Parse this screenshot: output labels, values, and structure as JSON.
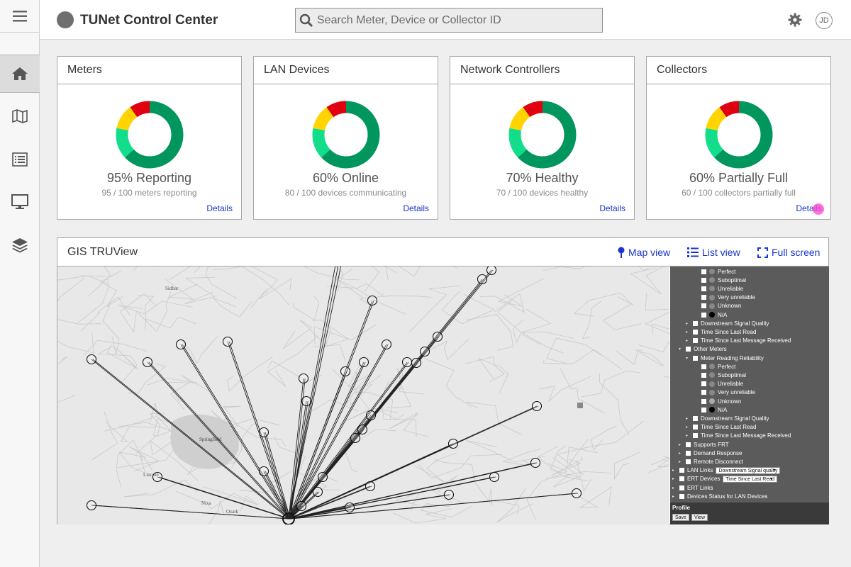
{
  "app": {
    "title": "TUNet Control Center",
    "user_initials": "JD"
  },
  "search": {
    "placeholder": "Search Meter, Device or Collector ID"
  },
  "colors": {
    "dark_green": "#00965e",
    "light_green": "#12dd8a",
    "yellow": "#ffd400",
    "red": "#e0000f",
    "link": "#1a35cc"
  },
  "nav": [
    "menu-icon",
    "home-icon",
    "map-icon",
    "list-icon",
    "monitor-icon",
    "layers-icon"
  ],
  "cards": [
    {
      "title": "Meters",
      "headline": "95% Reporting",
      "sub": "95 / 100 meters reporting",
      "link": "Details"
    },
    {
      "title": "LAN Devices",
      "headline": "60% Online",
      "sub": "80 / 100 devices communicating",
      "link": "Details"
    },
    {
      "title": "Network Controllers",
      "headline": "70% Healthy",
      "sub": "70 / 100 devices healthy",
      "link": "Details"
    },
    {
      "title": "Collectors",
      "headline": "60% Partially Full",
      "sub": "60 / 100 collectors partially full",
      "link": "Details"
    }
  ],
  "donut_segments": [
    {
      "name": "dark-green",
      "fraction": 0.63,
      "color": "#00965e"
    },
    {
      "name": "light-green",
      "fraction": 0.15,
      "color": "#12dd8a"
    },
    {
      "name": "yellow",
      "fraction": 0.12,
      "color": "#ffd400"
    },
    {
      "name": "red",
      "fraction": 0.1,
      "color": "#e0000f"
    }
  ],
  "gis": {
    "title": "GIS TRUView",
    "actions": {
      "map_view": "Map view",
      "list_view": "List view",
      "full_screen": "Full screen"
    },
    "map_labels": {
      "town1": "Sidbar",
      "town2": "Springfield",
      "town3": "Lincoln",
      "town4": "Nixa",
      "town5": "Ozark"
    }
  },
  "legend": {
    "rows": [
      {
        "label": "Perfect",
        "kind": "item",
        "dot": "#888888"
      },
      {
        "label": "Suboptimal",
        "kind": "item",
        "dot": "#888888"
      },
      {
        "label": "Unreliable",
        "kind": "item",
        "dot": "#888888"
      },
      {
        "label": "Very unreliable",
        "kind": "item",
        "dot": "#888888"
      },
      {
        "label": "Unknown",
        "kind": "item",
        "dot": "#888888"
      },
      {
        "label": "N/A",
        "kind": "item",
        "dot": "#000000"
      },
      {
        "label": "Downstream Signal Quality",
        "kind": "sub"
      },
      {
        "label": "Time Since Last Read",
        "kind": "sub"
      },
      {
        "label": "Time Since Last Message Received",
        "kind": "sub"
      },
      {
        "label": "Other Meters",
        "kind": "group"
      },
      {
        "label": "Meter Reading Reliability",
        "kind": "subopen"
      },
      {
        "label": "Perfect",
        "kind": "item",
        "dot": "#888888"
      },
      {
        "label": "Suboptimal",
        "kind": "item",
        "dot": "#888888"
      },
      {
        "label": "Unreliable",
        "kind": "item",
        "dot": "#888888"
      },
      {
        "label": "Very unreliable",
        "kind": "item",
        "dot": "#888888"
      },
      {
        "label": "Unknown",
        "kind": "item",
        "dot": "#aaaaaa"
      },
      {
        "label": "N/A",
        "kind": "item",
        "dot": "#000000"
      },
      {
        "label": "Downstream Signal Quality",
        "kind": "sub"
      },
      {
        "label": "Time Since Last Read",
        "kind": "sub"
      },
      {
        "label": "Time Since Last Message Received",
        "kind": "sub"
      },
      {
        "label": "Supports FRT",
        "kind": "group2"
      },
      {
        "label": "Demand Response",
        "kind": "group2"
      },
      {
        "label": "Remote Disconnect",
        "kind": "group2"
      },
      {
        "label": "LAN Links",
        "kind": "top",
        "select": "Downstream Signal quality"
      },
      {
        "label": "ERT Devices",
        "kind": "top",
        "select": "Time Since Last Read"
      },
      {
        "label": "ERT Links",
        "kind": "top"
      },
      {
        "label": "Devices Status for LAN Devices",
        "kind": "top"
      }
    ],
    "profile_label": "Profile",
    "save": "Save",
    "view": "View"
  }
}
